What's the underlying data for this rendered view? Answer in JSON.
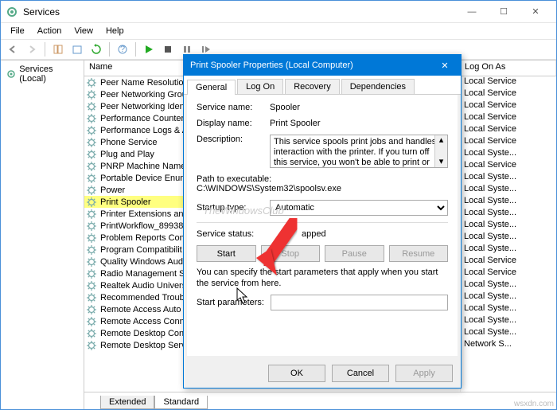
{
  "window": {
    "title": "Services",
    "menu": [
      "File",
      "Action",
      "View",
      "Help"
    ]
  },
  "left_pane": {
    "root": "Services (Local)"
  },
  "columns": {
    "name": "Name",
    "logon": "Log On As"
  },
  "services": [
    {
      "name": "Peer Name Resolution",
      "logon": "Local Service"
    },
    {
      "name": "Peer Networking Grou",
      "logon": "Local Service"
    },
    {
      "name": "Peer Networking Ident",
      "logon": "Local Service"
    },
    {
      "name": "Performance Counter",
      "logon": "Local Service"
    },
    {
      "name": "Performance Logs & A",
      "logon": "Local Service"
    },
    {
      "name": "Phone Service",
      "logon": "Local Service"
    },
    {
      "name": "Plug and Play",
      "logon": "Local Syste..."
    },
    {
      "name": "PNRP Machine Name",
      "logon": "Local Service"
    },
    {
      "name": "Portable Device Enum",
      "logon": "Local Syste..."
    },
    {
      "name": "Power",
      "logon": "Local Syste..."
    },
    {
      "name": "Print Spooler",
      "logon": "Local Syste...",
      "selected": true
    },
    {
      "name": "Printer Extensions and",
      "logon": "Local Syste..."
    },
    {
      "name": "PrintWorkflow_89938",
      "logon": "Local Syste..."
    },
    {
      "name": "Problem Reports Cont",
      "logon": "Local Syste..."
    },
    {
      "name": "Program Compatibilit",
      "logon": "Local Syste..."
    },
    {
      "name": "Quality Windows Audi",
      "logon": "Local Service"
    },
    {
      "name": "Radio Management Se",
      "logon": "Local Service"
    },
    {
      "name": "Realtek Audio Univers",
      "logon": "Local Syste..."
    },
    {
      "name": "Recommended Troubl",
      "logon": "Local Syste..."
    },
    {
      "name": "Remote Access Auto C",
      "logon": "Local Syste..."
    },
    {
      "name": "Remote Access Conne",
      "logon": "Local Syste..."
    },
    {
      "name": "Remote Desktop Conf",
      "logon": "Local Syste..."
    },
    {
      "name": "Remote Desktop Servi",
      "logon": "Network S..."
    }
  ],
  "bottom_tabs": {
    "extended": "Extended",
    "standard": "Standard"
  },
  "dialog": {
    "title": "Print Spooler Properties (Local Computer)",
    "tabs": [
      "General",
      "Log On",
      "Recovery",
      "Dependencies"
    ],
    "labels": {
      "service_name": "Service name:",
      "display_name": "Display name:",
      "description": "Description:",
      "path": "Path to executable:",
      "startup": "Startup type:",
      "status": "Service status:",
      "params": "Start parameters:"
    },
    "values": {
      "service_name": "Spooler",
      "display_name": "Print Spooler",
      "description": "This service spools print jobs and handles interaction with the printer.  If you turn off this service, you won't be able to print or see your printers",
      "path": "C:\\WINDOWS\\System32\\spoolsv.exe",
      "startup": "Automatic",
      "status": "apped",
      "hint": "You can specify the start parameters that apply when you start the service from here."
    },
    "buttons": {
      "start": "Start",
      "stop": "Stop",
      "pause": "Pause",
      "resume": "Resume",
      "ok": "OK",
      "cancel": "Cancel",
      "apply": "Apply"
    }
  },
  "watermark": "TheWindowsClub",
  "corner": "wsxdn.com"
}
